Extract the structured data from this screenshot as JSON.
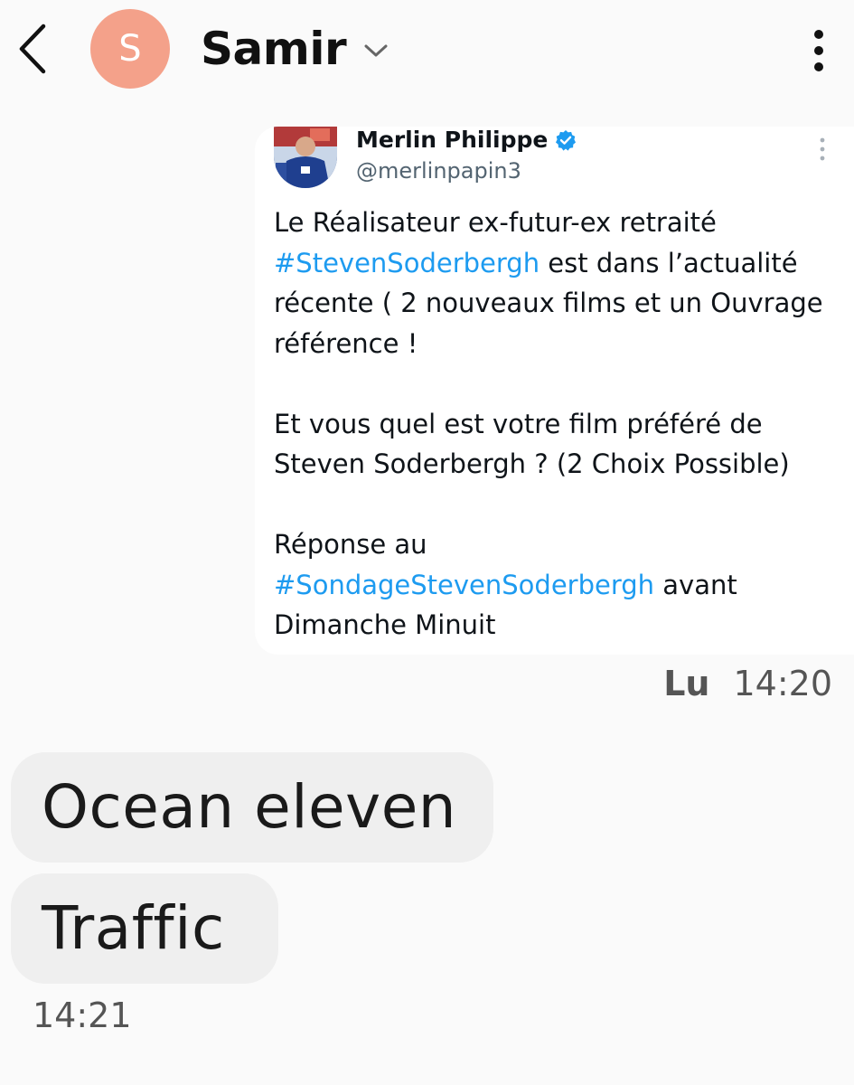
{
  "header": {
    "back_icon": "chevron-left-icon",
    "avatar_letter": "S",
    "avatar_color": "#f4a18a",
    "contact_name": "Samir",
    "expand_icon": "chevron-down-icon",
    "more_icon": "more-vertical-icon"
  },
  "tweet": {
    "author": "Merlin Philippe",
    "verified_icon": "verified-badge-icon",
    "handle": "@merlinpapin3",
    "more_icon": "more-vertical-icon",
    "p1_before": "Le Réalisateur ex-futur-ex retraité",
    "p1_hashtag": "#StevenSoderbergh",
    "p1_after": " est dans l’actualité récente ( 2 nouveaux films et un Ouvrage référence !",
    "p2": "Et vous quel est votre film préféré de Steven Soderbergh ? (2 Choix Possible)",
    "p3_before": "Réponse au",
    "p3_hashtag": "#SondageStevenSoderbergh",
    "p3_after": " avant Dimanche Minuit",
    "hashtag_color": "#1d9bf0"
  },
  "sent_meta": {
    "read_label": "Lu",
    "time": "14:20"
  },
  "received": {
    "messages": [
      {
        "text": "Ocean eleven"
      },
      {
        "text": "Traffic"
      }
    ],
    "time": "14:21",
    "bubble_color": "#efefef"
  }
}
